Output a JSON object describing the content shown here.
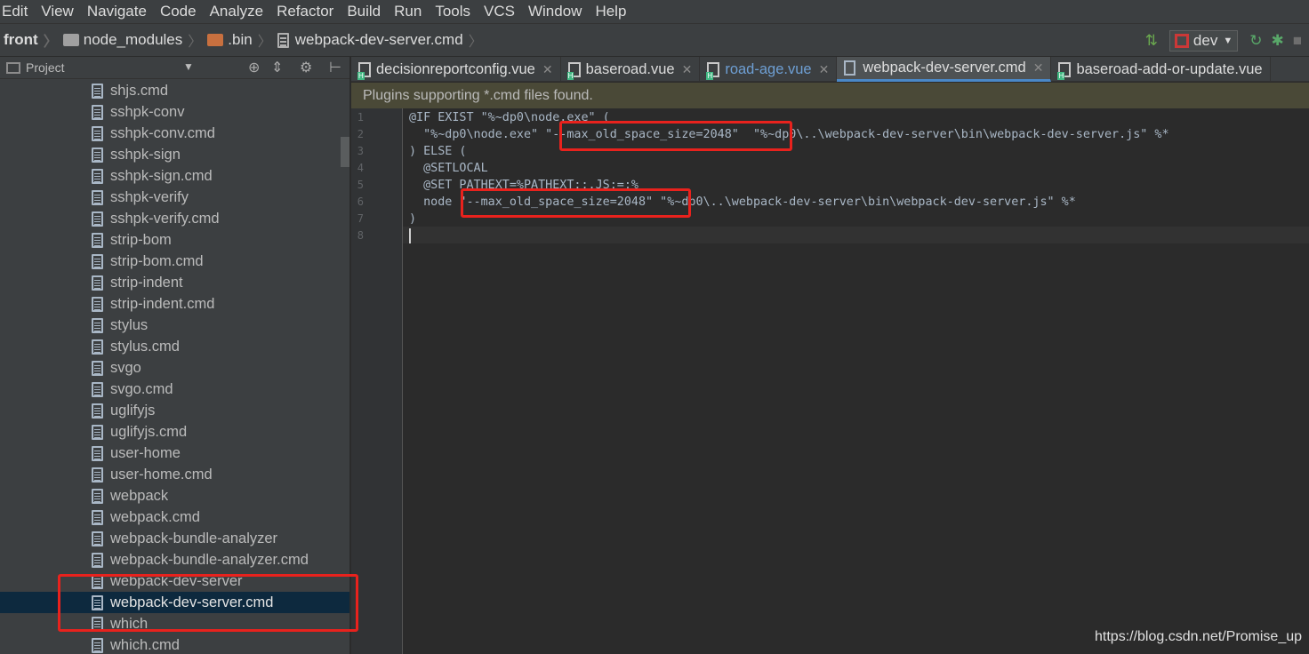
{
  "menu": [
    "Edit",
    "View",
    "Navigate",
    "Code",
    "Analyze",
    "Refactor",
    "Build",
    "Run",
    "Tools",
    "VCS",
    "Window",
    "Help"
  ],
  "breadcrumb": {
    "root": "front",
    "folder1": "node_modules",
    "folder2": ".bin",
    "file": "webpack-dev-server.cmd"
  },
  "run_config": {
    "label": "dev",
    "icons": [
      "build-icon",
      "npm-icon",
      "dropdown-icon",
      "rerun-icon",
      "bug-icon",
      "stop-icon"
    ]
  },
  "project_panel": {
    "title": "Project"
  },
  "tree_items": [
    "shjs.cmd",
    "sshpk-conv",
    "sshpk-conv.cmd",
    "sshpk-sign",
    "sshpk-sign.cmd",
    "sshpk-verify",
    "sshpk-verify.cmd",
    "strip-bom",
    "strip-bom.cmd",
    "strip-indent",
    "strip-indent.cmd",
    "stylus",
    "stylus.cmd",
    "svgo",
    "svgo.cmd",
    "uglifyjs",
    "uglifyjs.cmd",
    "user-home",
    "user-home.cmd",
    "webpack",
    "webpack.cmd",
    "webpack-bundle-analyzer",
    "webpack-bundle-analyzer.cmd",
    "webpack-dev-server",
    "webpack-dev-server.cmd",
    "which",
    "which.cmd"
  ],
  "selected_tree_item": "webpack-dev-server.cmd",
  "tabs": [
    {
      "label": "decisionreportconfig.vue",
      "type": "vue",
      "active": false
    },
    {
      "label": "baseroad.vue",
      "type": "vue",
      "active": false
    },
    {
      "label": "road-age.vue",
      "type": "vue",
      "active": false
    },
    {
      "label": "webpack-dev-server.cmd",
      "type": "cmd",
      "active": true
    },
    {
      "label": "baseroad-add-or-update.vue",
      "type": "vue",
      "active": false
    }
  ],
  "notification": "Plugins supporting *.cmd files found.",
  "line_numbers": [
    "1",
    "2",
    "3",
    "4",
    "5",
    "6",
    "7",
    "8"
  ],
  "code_lines": [
    "@IF EXIST \"%~dp0\\node.exe\" (",
    "  \"%~dp0\\node.exe\" \"--max_old_space_size=2048\"  \"%~dp0\\..\\webpack-dev-server\\bin\\webpack-dev-server.js\" %*",
    ") ELSE (",
    "  @SETLOCAL",
    "  @SET PATHEXT=%PATHEXT:;.JS;=;%",
    "  node \"--max_old_space_size=2048\" \"%~dp0\\..\\webpack-dev-server\\bin\\webpack-dev-server.js\" %*",
    ")",
    ""
  ],
  "watermark": "https://blog.csdn.net/Promise_up",
  "colors": {
    "highlight_box": "#e8221d",
    "selection": "#0d293e",
    "active_tab_underline": "#4a88c7",
    "notification_bg": "#4a4937"
  }
}
